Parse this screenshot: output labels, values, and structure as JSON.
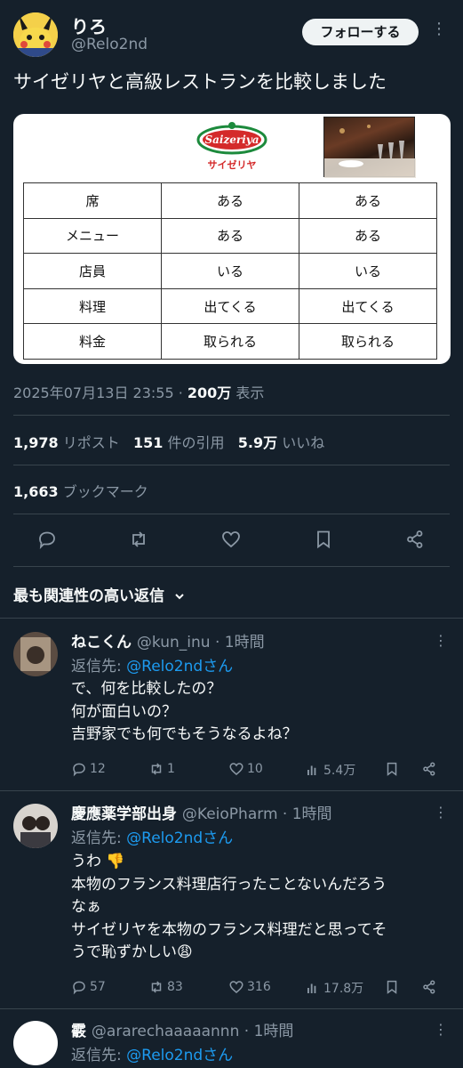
{
  "author": {
    "name": "りろ",
    "handle": "@Relo2nd"
  },
  "follow_label": "フォローする",
  "tweet_text": "サイゼリヤと高級レストランを比較しました",
  "image": {
    "logo_text": "Saizeriya",
    "logo_subtext": "サイゼリヤ",
    "table": [
      [
        "席",
        "ある",
        "ある"
      ],
      [
        "メニュー",
        "ある",
        "ある"
      ],
      [
        "店員",
        "いる",
        "いる"
      ],
      [
        "料理",
        "出てくる",
        "出てくる"
      ],
      [
        "料金",
        "取られる",
        "取られる"
      ]
    ]
  },
  "meta": {
    "datetime": "2025年07月13日 23:55",
    "views": "200万",
    "views_label": "表示"
  },
  "stats": {
    "reposts": "1,978",
    "reposts_label": "リポスト",
    "quotes": "151",
    "quotes_label": "件の引用",
    "likes": "5.9万",
    "likes_label": "いいね",
    "bookmarks": "1,663",
    "bookmarks_label": "ブックマーク"
  },
  "sort_label": "最も関連性の高い返信",
  "replies": [
    {
      "name": "ねこくん",
      "handle": "@kun_inu",
      "time": "1時間",
      "reply_to_label": "返信先:",
      "reply_to": "@Relo2ndさん",
      "text": "で、何を比較したの？\n何が面白いの？\n吉野家でも何でもそうなるよね？",
      "replies": "12",
      "reposts": "1",
      "likes": "10",
      "views": "5.4万"
    },
    {
      "name": "慶應薬学部出身",
      "handle": "@KeioPharm",
      "time": "1時間",
      "reply_to_label": "返信先:",
      "reply_to": "@Relo2ndさん",
      "text": "うわ 👎\n本物のフランス料理店行ったことないんだろう\nなぁ\nサイゼリヤを本物のフランス料理だと思ってそ\nうで恥ずかしい😩",
      "replies": "57",
      "reposts": "83",
      "likes": "316",
      "views": "17.8万"
    },
    {
      "name": "霰",
      "handle": "@ararechaaaaannn",
      "time": "1時間",
      "reply_to_label": "返信先:",
      "reply_to": "@Relo2ndさん"
    }
  ]
}
